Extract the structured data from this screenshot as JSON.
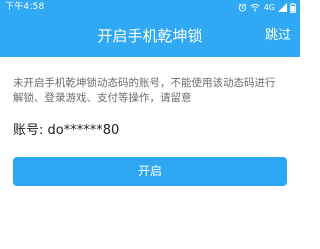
{
  "status_bar": {
    "time": "下午4:58",
    "network": "4G",
    "icons": [
      "alarm-icon",
      "wifi-icon",
      "network-label",
      "signal-icon",
      "battery-icon"
    ]
  },
  "header": {
    "title": "开启手机乾坤锁",
    "skip_label": "跳过"
  },
  "main": {
    "notice_line1": "未开启手机乾坤锁动态码的账号，不能使用该动态码进行",
    "notice_line2": "解锁、登录游戏、支付等操作，请留意",
    "account_label": "账号:",
    "account_value": "do******80",
    "open_button_label": "开启"
  },
  "colors": {
    "brand": "#2fa9f3",
    "button": "#2ea7f2",
    "notice_text": "#6c6c6c"
  }
}
